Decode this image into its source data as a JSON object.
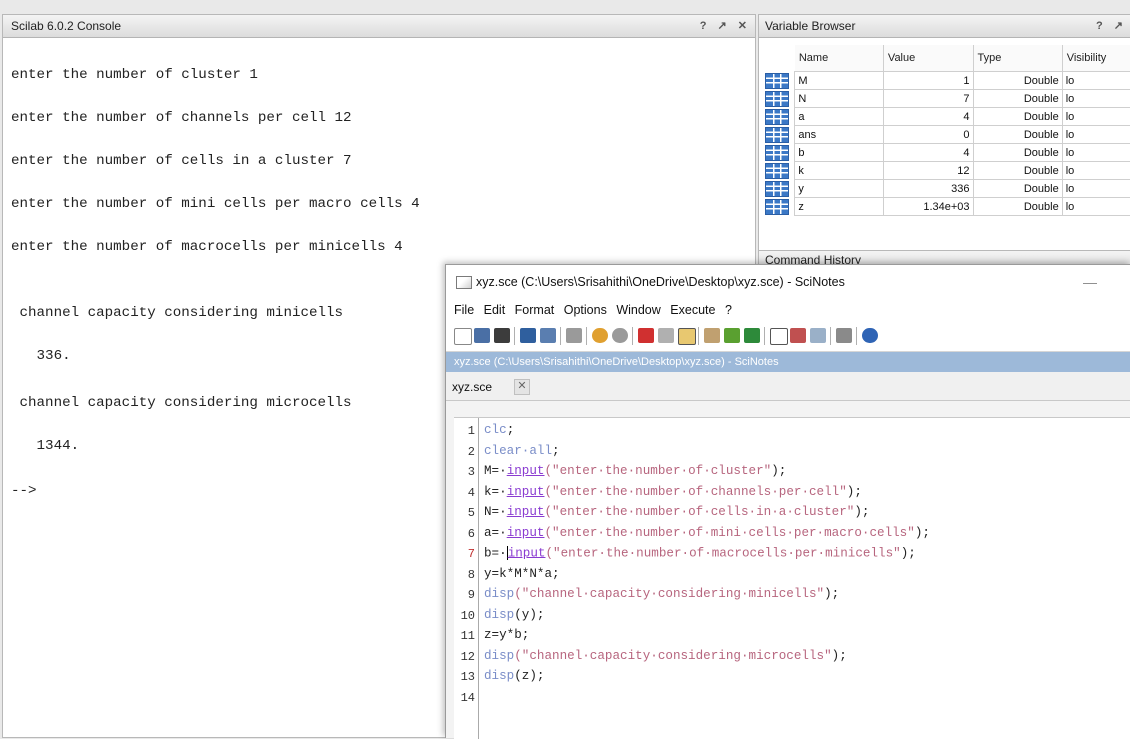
{
  "console": {
    "title": "Scilab 6.0.2 Console",
    "controls": [
      "?",
      "↗",
      "✕"
    ],
    "lines": [
      "enter the number of cluster 1",
      "enter the number of channels per cell 12",
      "enter the number of cells in a cluster 7",
      "enter the number of mini cells per macro cells 4",
      "enter the number of macrocells per minicells 4",
      " channel capacity considering minicells",
      "   336.",
      " channel capacity considering microcells",
      "   1344.",
      "-->"
    ]
  },
  "variable_browser": {
    "title": "Variable Browser",
    "controls": [
      "?",
      "↗"
    ],
    "columns": [
      "Name",
      "Value",
      "Type",
      "Visibility"
    ],
    "rows": [
      {
        "name": "M",
        "value": "1",
        "type": "Double",
        "visibility": "lo"
      },
      {
        "name": "N",
        "value": "7",
        "type": "Double",
        "visibility": "lo"
      },
      {
        "name": "a",
        "value": "4",
        "type": "Double",
        "visibility": "lo"
      },
      {
        "name": "ans",
        "value": "0",
        "type": "Double",
        "visibility": "lo"
      },
      {
        "name": "b",
        "value": "4",
        "type": "Double",
        "visibility": "lo"
      },
      {
        "name": "k",
        "value": "12",
        "type": "Double",
        "visibility": "lo"
      },
      {
        "name": "y",
        "value": "336",
        "type": "Double",
        "visibility": "lo"
      },
      {
        "name": "z",
        "value": "1.34e+03",
        "type": "Double",
        "visibility": "lo"
      }
    ]
  },
  "command_history": {
    "title": "Command History"
  },
  "scinotes": {
    "window_title": "xyz.sce (C:\\Users\\Srisahithi\\OneDrive\\Desktop\\xyz.sce) - SciNotes",
    "minimize": "—",
    "menu": [
      "File",
      "Edit",
      "Format",
      "Options",
      "Window",
      "Execute",
      "?"
    ],
    "path_bar": "xyz.sce (C:\\Users\\Srisahithi\\OneDrive\\Desktop\\xyz.sce) - SciNotes",
    "tab": {
      "label": "xyz.sce",
      "close": "✕"
    },
    "lines": [
      {
        "n": "1",
        "segments": [
          {
            "t": "clc",
            "c": "kw"
          },
          {
            "t": ";",
            "c": "op"
          }
        ]
      },
      {
        "n": "2",
        "segments": [
          {
            "t": "clear·all",
            "c": "kw"
          },
          {
            "t": ";",
            "c": "op"
          }
        ]
      },
      {
        "n": "3",
        "segments": [
          {
            "t": "M=·",
            "c": "op"
          },
          {
            "t": "input",
            "c": "fn"
          },
          {
            "t": "(\"enter·the·number·of·cluster\"",
            "c": "str"
          },
          {
            "t": ");",
            "c": "op"
          }
        ]
      },
      {
        "n": "4",
        "segments": [
          {
            "t": "k=·",
            "c": "op"
          },
          {
            "t": "input",
            "c": "fn"
          },
          {
            "t": "(\"enter·the·number·of·channels·per·cell\"",
            "c": "str"
          },
          {
            "t": ");",
            "c": "op"
          }
        ]
      },
      {
        "n": "5",
        "segments": [
          {
            "t": "N=·",
            "c": "op"
          },
          {
            "t": "input",
            "c": "fn"
          },
          {
            "t": "(\"enter·the·number·of·cells·in·a·cluster\"",
            "c": "str"
          },
          {
            "t": ");",
            "c": "op"
          }
        ]
      },
      {
        "n": "6",
        "segments": [
          {
            "t": "a=·",
            "c": "op"
          },
          {
            "t": "input",
            "c": "fn"
          },
          {
            "t": "(\"enter·the·number·of·mini·cells·per·macro·cells\"",
            "c": "str"
          },
          {
            "t": ");",
            "c": "op"
          }
        ]
      },
      {
        "n": "7",
        "segments": [
          {
            "t": "b=·",
            "c": "op"
          },
          {
            "t": "input",
            "c": "fn"
          },
          {
            "t": "(\"enter·the·number·of·macrocells·per·minicells\"",
            "c": "str"
          },
          {
            "t": ");",
            "c": "op"
          }
        ]
      },
      {
        "n": "8",
        "segments": [
          {
            "t": "y=k*M*N*a;",
            "c": "op"
          }
        ]
      },
      {
        "n": "9",
        "segments": [
          {
            "t": "disp",
            "c": "kw"
          },
          {
            "t": "(\"channel·capacity·considering·minicells\"",
            "c": "str"
          },
          {
            "t": ");",
            "c": "op"
          }
        ]
      },
      {
        "n": "10",
        "segments": [
          {
            "t": "disp",
            "c": "kw"
          },
          {
            "t": "(y);",
            "c": "op"
          }
        ]
      },
      {
        "n": "11",
        "segments": [
          {
            "t": "z=y*b;",
            "c": "op"
          }
        ]
      },
      {
        "n": "12",
        "segments": [
          {
            "t": "disp",
            "c": "kw"
          },
          {
            "t": "(\"channel·capacity·considering·microcells\"",
            "c": "str"
          },
          {
            "t": ");",
            "c": "op"
          }
        ]
      },
      {
        "n": "13",
        "segments": [
          {
            "t": "disp",
            "c": "kw"
          },
          {
            "t": "(z);",
            "c": "op"
          }
        ]
      },
      {
        "n": "14",
        "segments": []
      }
    ]
  }
}
